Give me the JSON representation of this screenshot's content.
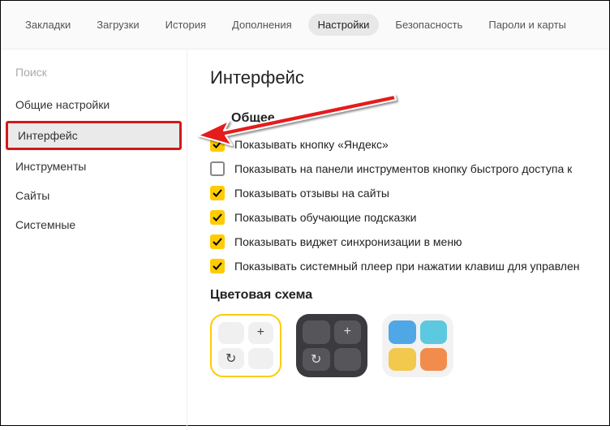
{
  "topnav": {
    "items": [
      {
        "label": "Закладки"
      },
      {
        "label": "Загрузки"
      },
      {
        "label": "История"
      },
      {
        "label": "Дополнения"
      },
      {
        "label": "Настройки",
        "active": true
      },
      {
        "label": "Безопасность"
      },
      {
        "label": "Пароли и карты"
      }
    ]
  },
  "sidebar": {
    "search_placeholder": "Поиск",
    "items": [
      {
        "label": "Общие настройки"
      },
      {
        "label": "Интерфейс",
        "active": true
      },
      {
        "label": "Инструменты"
      },
      {
        "label": "Сайты"
      },
      {
        "label": "Системные"
      }
    ]
  },
  "main": {
    "title": "Интерфейс",
    "section_general": "Общее",
    "options": [
      {
        "label": "Показывать кнопку «Яндекс»",
        "checked": true
      },
      {
        "label": "Показывать на панели инструментов кнопку быстрого доступа к",
        "checked": false
      },
      {
        "label": "Показывать отзывы на сайты",
        "checked": true
      },
      {
        "label": "Показывать обучающие подсказки",
        "checked": true
      },
      {
        "label": "Показывать виджет синхронизации в меню",
        "checked": true
      },
      {
        "label": "Показывать системный плеер при нажатии клавиш для управлен",
        "checked": true
      }
    ],
    "section_color": "Цветовая схема"
  }
}
